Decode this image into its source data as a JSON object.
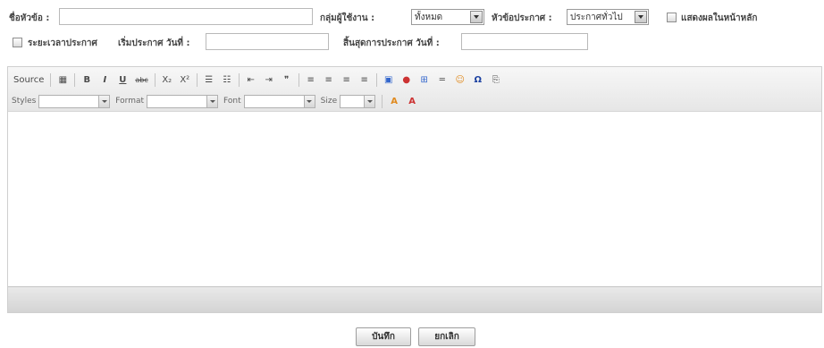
{
  "form": {
    "title_label": "ชื่อหัวข้อ :",
    "title_value": "",
    "usergroup_label": "กลุ่มผู้ใช้งาน :",
    "usergroup_value": "ทั้งหมด",
    "topic_label": "หัวข้อประกาศ :",
    "topic_value": "ประกาศทั่วไป",
    "show_home_label": "แสดงผลในหน้าหลัก",
    "period_label": "ระยะเวลาประกาศ",
    "start_label": "เริ่มประกาศ วันที่ :",
    "start_value": "",
    "end_label": "สิ้นสุดการประกาศ วันที่ :",
    "end_value": ""
  },
  "toolbar": {
    "row1": [
      {
        "name": "source-button",
        "label": "Source",
        "icon": "source-icon"
      },
      {
        "sep": true
      },
      {
        "name": "templates-button",
        "label": "▦",
        "icon": "templates-icon"
      },
      {
        "sep": true
      },
      {
        "name": "bold-button",
        "label": "B",
        "icon": "bold-icon"
      },
      {
        "name": "italic-button",
        "label": "I",
        "icon": "italic-icon"
      },
      {
        "name": "underline-button",
        "label": "U",
        "icon": "underline-icon"
      },
      {
        "name": "strike-button",
        "label": "abc",
        "icon": "strike-icon"
      },
      {
        "sep": true
      },
      {
        "name": "subscript-button",
        "label": "X₂",
        "icon": "subscript-icon"
      },
      {
        "name": "superscript-button",
        "label": "X²",
        "icon": "superscript-icon"
      },
      {
        "sep": true
      },
      {
        "name": "numbered-list-button",
        "label": "☰",
        "icon": "numbered-list-icon"
      },
      {
        "name": "bulleted-list-button",
        "label": "☷",
        "icon": "bulleted-list-icon"
      },
      {
        "sep": true
      },
      {
        "name": "outdent-button",
        "label": "⇤",
        "icon": "outdent-icon"
      },
      {
        "name": "indent-button",
        "label": "⇥",
        "icon": "indent-icon"
      },
      {
        "name": "blockquote-button",
        "label": "❞",
        "icon": "blockquote-icon"
      },
      {
        "sep": true
      },
      {
        "name": "align-left-button",
        "label": "≡",
        "icon": "align-left-icon"
      },
      {
        "name": "align-center-button",
        "label": "≡",
        "icon": "align-center-icon"
      },
      {
        "name": "align-right-button",
        "label": "≡",
        "icon": "align-right-icon"
      },
      {
        "name": "align-justify-button",
        "label": "≡",
        "icon": "align-justify-icon"
      },
      {
        "sep": true
      },
      {
        "name": "image-button",
        "label": "▣",
        "icon": "image-icon"
      },
      {
        "name": "flash-button",
        "label": "●",
        "icon": "flash-icon"
      },
      {
        "name": "table-button",
        "label": "⊞",
        "icon": "table-icon"
      },
      {
        "name": "hr-button",
        "label": "═",
        "icon": "horizontal-rule-icon"
      },
      {
        "name": "smiley-button",
        "label": "☺",
        "icon": "smiley-icon"
      },
      {
        "name": "special-char-button",
        "label": "Ω",
        "icon": "omega-icon"
      },
      {
        "name": "pagebreak-button",
        "label": "⎘",
        "icon": "pagebreak-icon"
      }
    ],
    "styles_label": "Styles",
    "format_label": "Format",
    "font_label": "Font",
    "size_label": "Size",
    "text_color_label": "A",
    "bg_color_label": "A"
  },
  "colors": {
    "accent_bold": "#1a3fa0",
    "icon_red": "#cc3333",
    "icon_orange": "#e08a1e",
    "icon_blue": "#3366cc"
  },
  "buttons": {
    "save_label": "บันทึก",
    "cancel_label": "ยกเลิก"
  }
}
